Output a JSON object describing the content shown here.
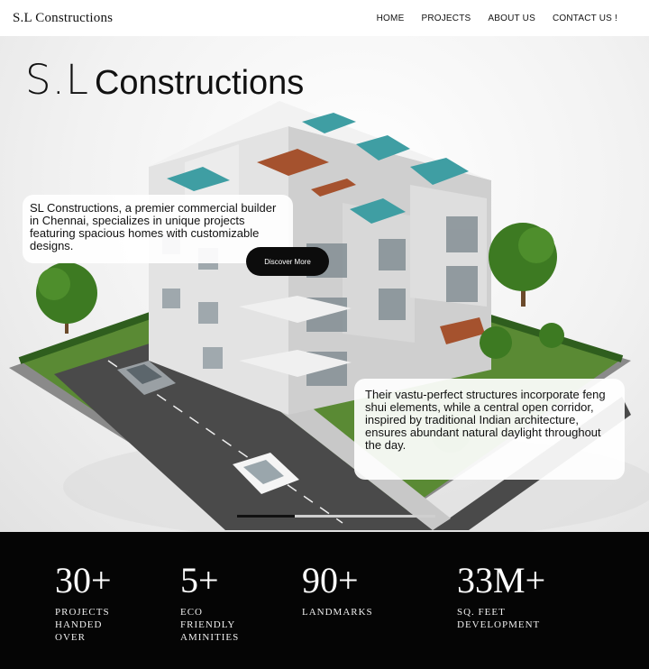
{
  "header": {
    "brand": "S.L Constructions",
    "nav": [
      "HOME",
      "PROJECTS",
      "ABOUT US",
      "CONTACT US !"
    ]
  },
  "hero": {
    "title_part1": "S.L",
    "title_part2": "Constructions",
    "intro": "SL Constructions, a premier commercial builder in Chennai, specializes in unique projects featuring spacious homes with customizable designs.",
    "cta": "Discover More",
    "detail": "Their vastu-perfect structures incorporate feng shui elements, while a central open corridor, inspired by traditional Indian architecture, ensures abundant natural daylight throughout the day.",
    "slider_progress": 0.29
  },
  "stats": [
    {
      "value": "30+",
      "label": "PROJECTS\nHANDED\nOVER"
    },
    {
      "value": "5+",
      "label": "ECO\n FRIENDLY\nAMINITIES"
    },
    {
      "value": "90+",
      "label": "LANDMARKS"
    },
    {
      "value": "33M+",
      "label": " SQ. FEET\n DEVELOPMENT"
    }
  ],
  "colors": {
    "background": "#ffffff",
    "stats_background": "#050505",
    "button": "#0c0c0c",
    "pool": "#3f9ea3",
    "lawn": "#4d7a2d"
  }
}
